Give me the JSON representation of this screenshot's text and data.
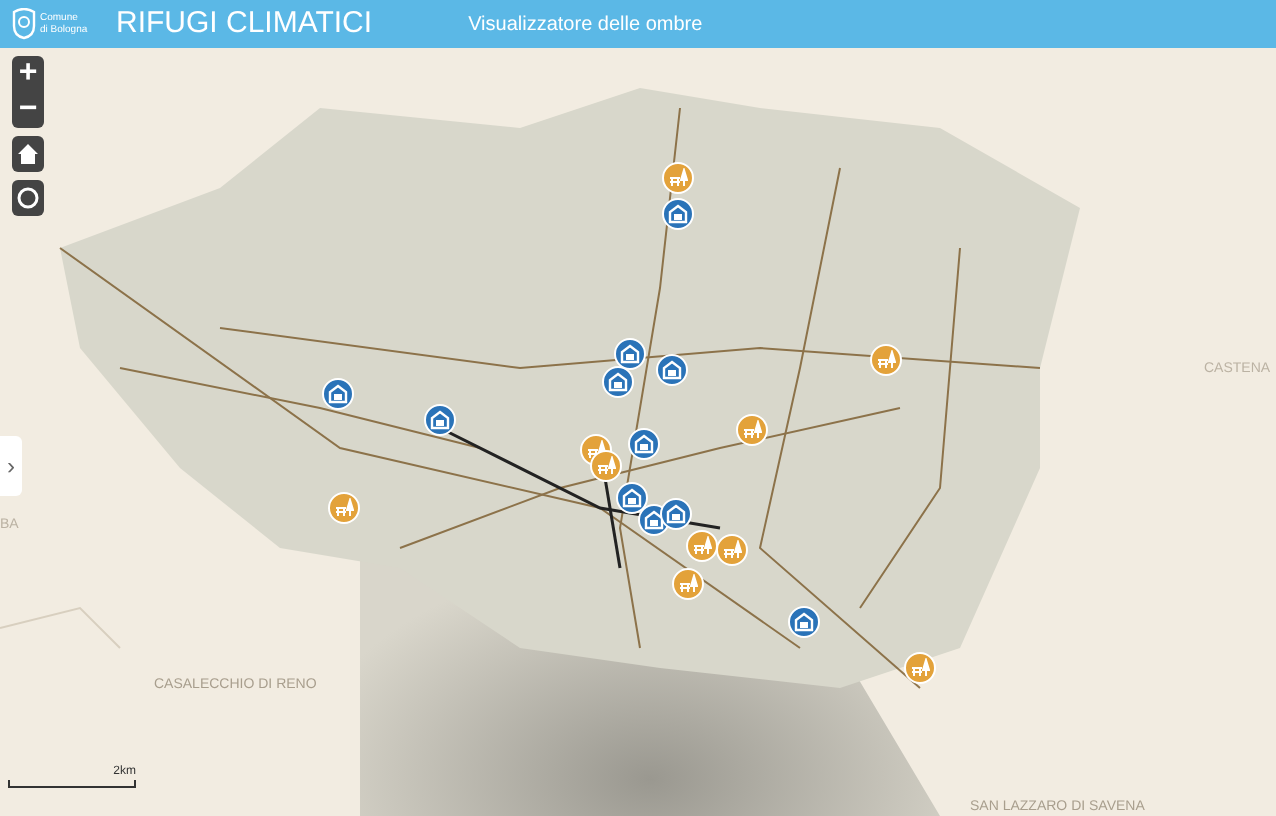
{
  "header": {
    "logo_text": "Comune di Bologna",
    "title": "RIFUGI CLIMATICI",
    "subtitle": "Visualizzatore delle ombre"
  },
  "map_controls": [
    {
      "kind": "zoom_in",
      "label": "+"
    },
    {
      "kind": "zoom_out",
      "label": "−"
    },
    {
      "kind": "home"
    },
    {
      "kind": "locate"
    }
  ],
  "side_toggle": {
    "label": "›"
  },
  "place_labels": [
    "CASTENA",
    "BA",
    "CASALECCHIO DI RENO",
    "SAN LAZZARO DI SAVENA"
  ],
  "scale": {
    "label": "2km"
  },
  "markers": [
    {
      "kind": "building"
    },
    {
      "kind": "building"
    },
    {
      "kind": "building"
    },
    {
      "kind": "building"
    },
    {
      "kind": "building"
    },
    {
      "kind": "building"
    },
    {
      "kind": "building"
    },
    {
      "kind": "building"
    },
    {
      "kind": "building"
    },
    {
      "kind": "building"
    },
    {
      "kind": "building"
    },
    {
      "kind": "park"
    },
    {
      "kind": "park"
    },
    {
      "kind": "park"
    },
    {
      "kind": "park"
    },
    {
      "kind": "park"
    },
    {
      "kind": "park"
    },
    {
      "kind": "park"
    },
    {
      "kind": "park"
    },
    {
      "kind": "park"
    },
    {
      "kind": "park"
    }
  ]
}
